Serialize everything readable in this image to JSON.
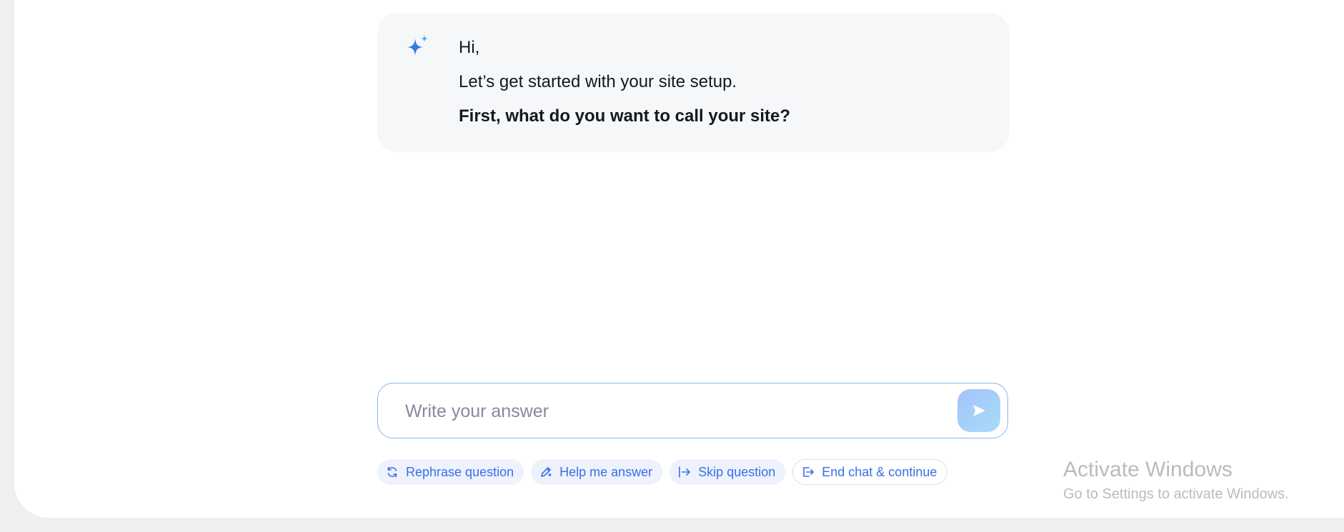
{
  "assistant_message": {
    "greeting": "Hi,",
    "intro": "Let’s get started with your site setup.",
    "question": "First, what do you want to call your site?",
    "icon": "sparkle-icon",
    "accent_color": "#2f7de6"
  },
  "answer": {
    "placeholder": "Write your answer",
    "value": "",
    "send_icon": "send-arrow-icon"
  },
  "actions": [
    {
      "label": "Rephrase question",
      "icon": "refresh-icon"
    },
    {
      "label": "Help me answer",
      "icon": "magic-pen-icon"
    },
    {
      "label": "Skip question",
      "icon": "skip-arrow-icon"
    },
    {
      "label": "End chat & continue",
      "icon": "exit-icon"
    }
  ],
  "watermark": {
    "title": "Activate Windows",
    "subtitle": "Go to Settings to activate Windows."
  }
}
